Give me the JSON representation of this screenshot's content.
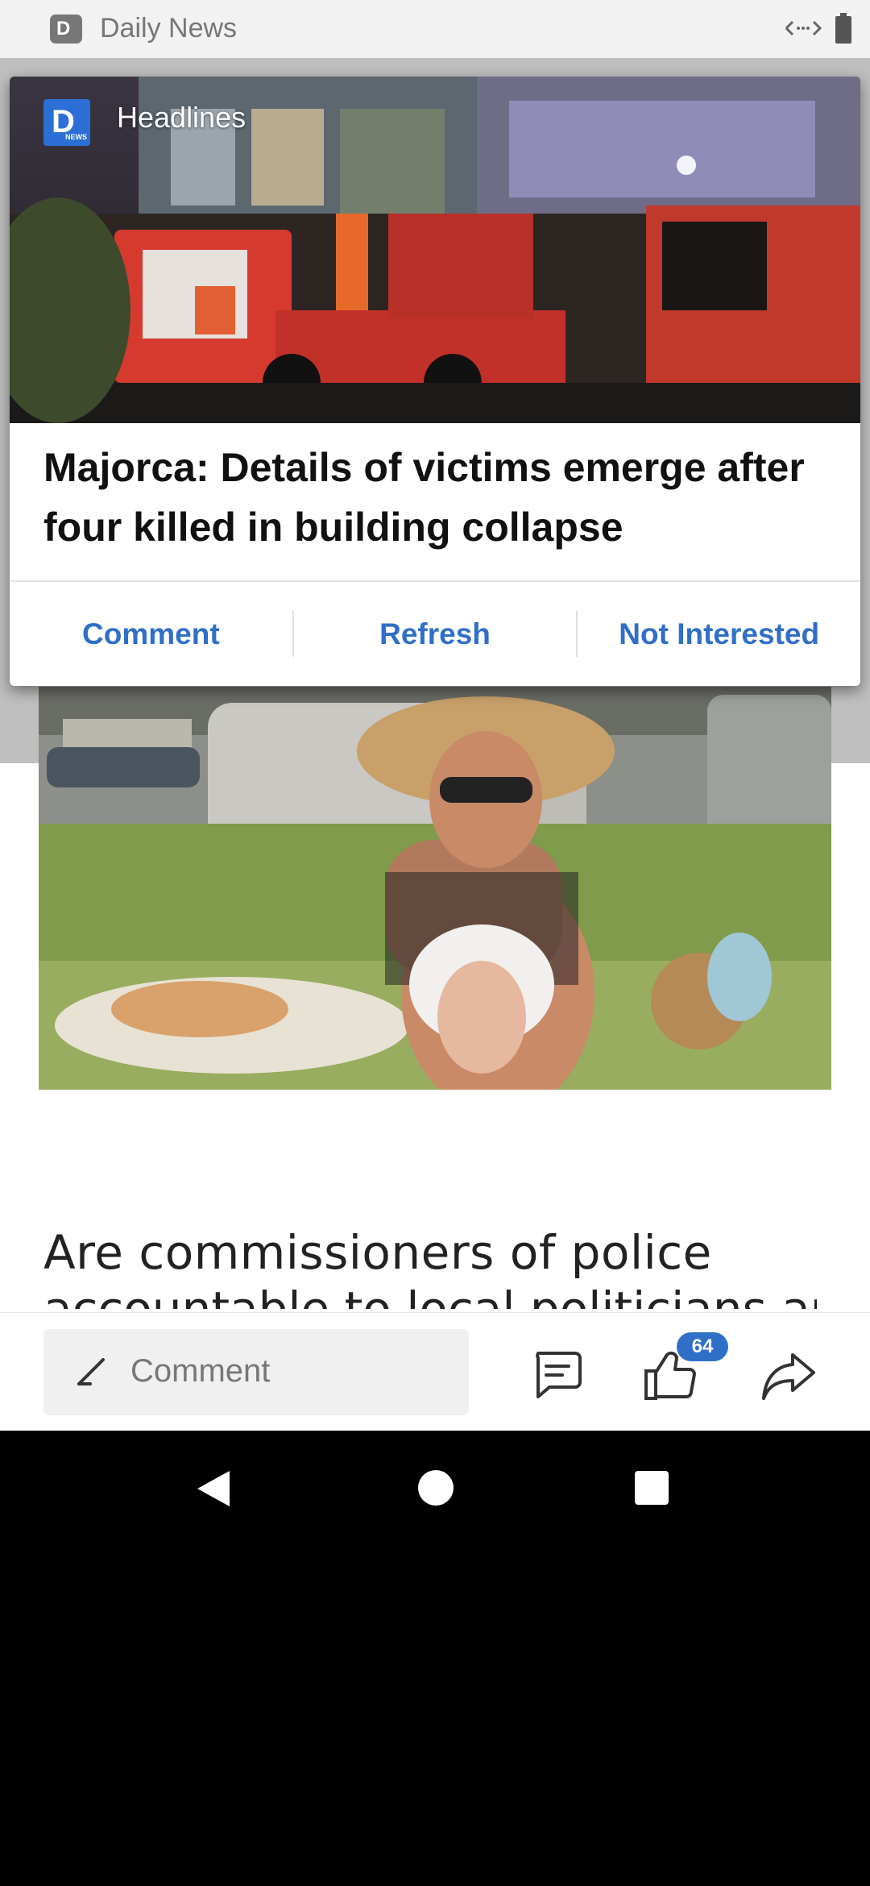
{
  "status_bar": {
    "app_name": "Daily News",
    "app_badge_letter": "D"
  },
  "notification": {
    "source_name": "Headlines",
    "source_icon_letter": "D",
    "source_icon_sub": "NEWS",
    "title": "Majorca: Details of victims emerge after four killed in building collapse",
    "actions": [
      "Comment",
      "Refresh",
      "Not Interested"
    ]
  },
  "article": {
    "body_line_1": "Are commissioners of police",
    "body_line_2": "accountable to local politicians and"
  },
  "toolbar": {
    "comment_placeholder": "Comment",
    "like_count": "64"
  },
  "colors": {
    "accent": "#2f6fc8",
    "nav_background": "#000000"
  }
}
